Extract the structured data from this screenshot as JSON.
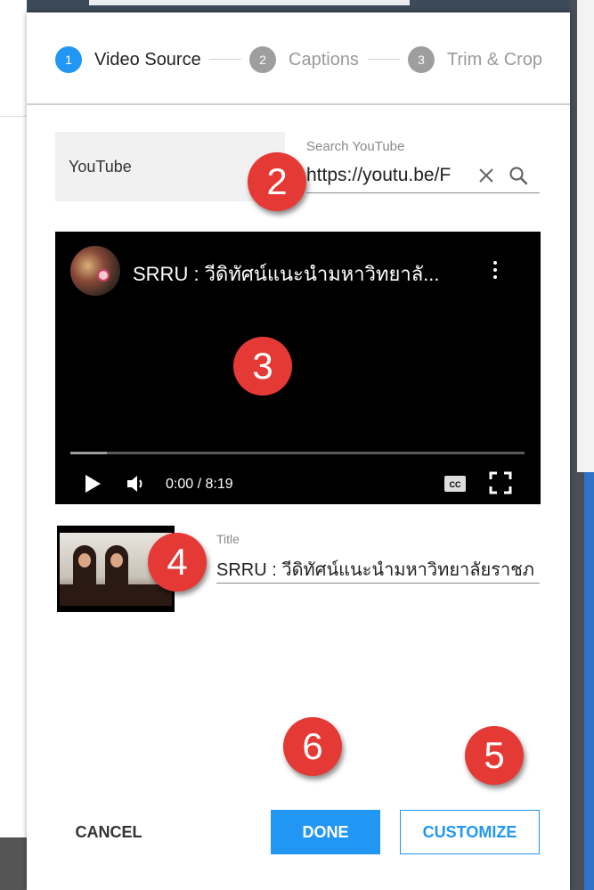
{
  "stepper": {
    "steps": [
      {
        "number": "1",
        "label": "Video Source",
        "state": "active"
      },
      {
        "number": "2",
        "label": "Captions",
        "state": "inactive"
      },
      {
        "number": "3",
        "label": "Trim & Crop",
        "state": "inactive"
      }
    ]
  },
  "source": {
    "tab_label": "YouTube",
    "search_label": "Search YouTube",
    "search_value": "https://youtu.be/F"
  },
  "player": {
    "video_title": "SRRU : วีดิทัศน์แนะนำมหาวิทยาลั...",
    "time": "0:00 / 8:19",
    "progress_buffered": 0.08,
    "progress_played": 0
  },
  "details": {
    "title_label": "Title",
    "title_value": "SRRU : วีดิทัศน์แนะนำมหาวิทยาลัยราชภ"
  },
  "footer": {
    "cancel_label": "CANCEL",
    "done_label": "DONE",
    "customize_label": "CUSTOMIZE"
  },
  "callouts": [
    "2",
    "3",
    "4",
    "5",
    "6"
  ],
  "colors": {
    "accent": "#2196f3",
    "callout": "#e53935",
    "player_bg": "#000000"
  },
  "icons": [
    "close-icon",
    "search-icon",
    "more-vert-icon",
    "play-icon",
    "volume-icon",
    "closed-captions-icon",
    "fullscreen-icon"
  ]
}
